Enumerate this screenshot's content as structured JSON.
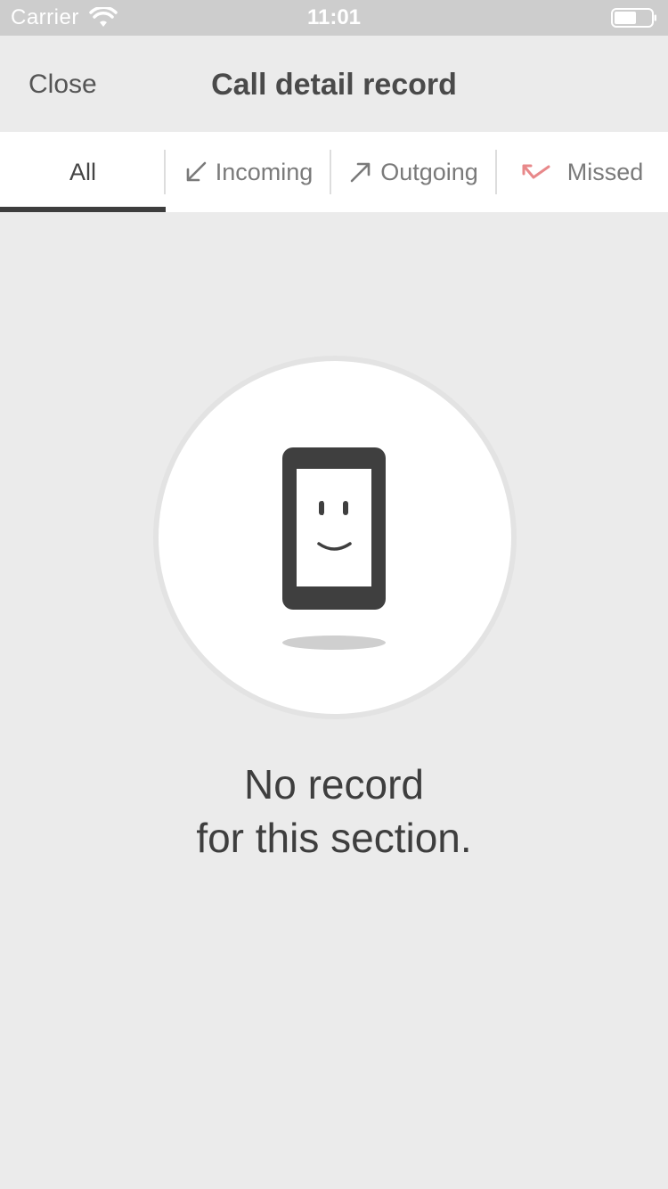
{
  "status_bar": {
    "carrier": "Carrier",
    "time": "11:01",
    "wifi_icon": "wifi-icon",
    "battery_icon": "battery-icon"
  },
  "nav": {
    "close_label": "Close",
    "title": "Call detail record"
  },
  "tabs": [
    {
      "label": "All",
      "icon": null,
      "selected": true
    },
    {
      "label": "Incoming",
      "icon": "arrow-down-left-icon",
      "selected": false
    },
    {
      "label": "Outgoing",
      "icon": "arrow-up-right-icon",
      "selected": false
    },
    {
      "label": "Missed",
      "icon": "missed-call-icon",
      "selected": false
    }
  ],
  "empty_state": {
    "icon": "smiling-phone-icon",
    "line1": "No record",
    "line2": "for this section."
  },
  "colors": {
    "missed_accent": "#e8888a",
    "selected_indicator": "#3d3d3d",
    "background": "#ebebeb"
  }
}
